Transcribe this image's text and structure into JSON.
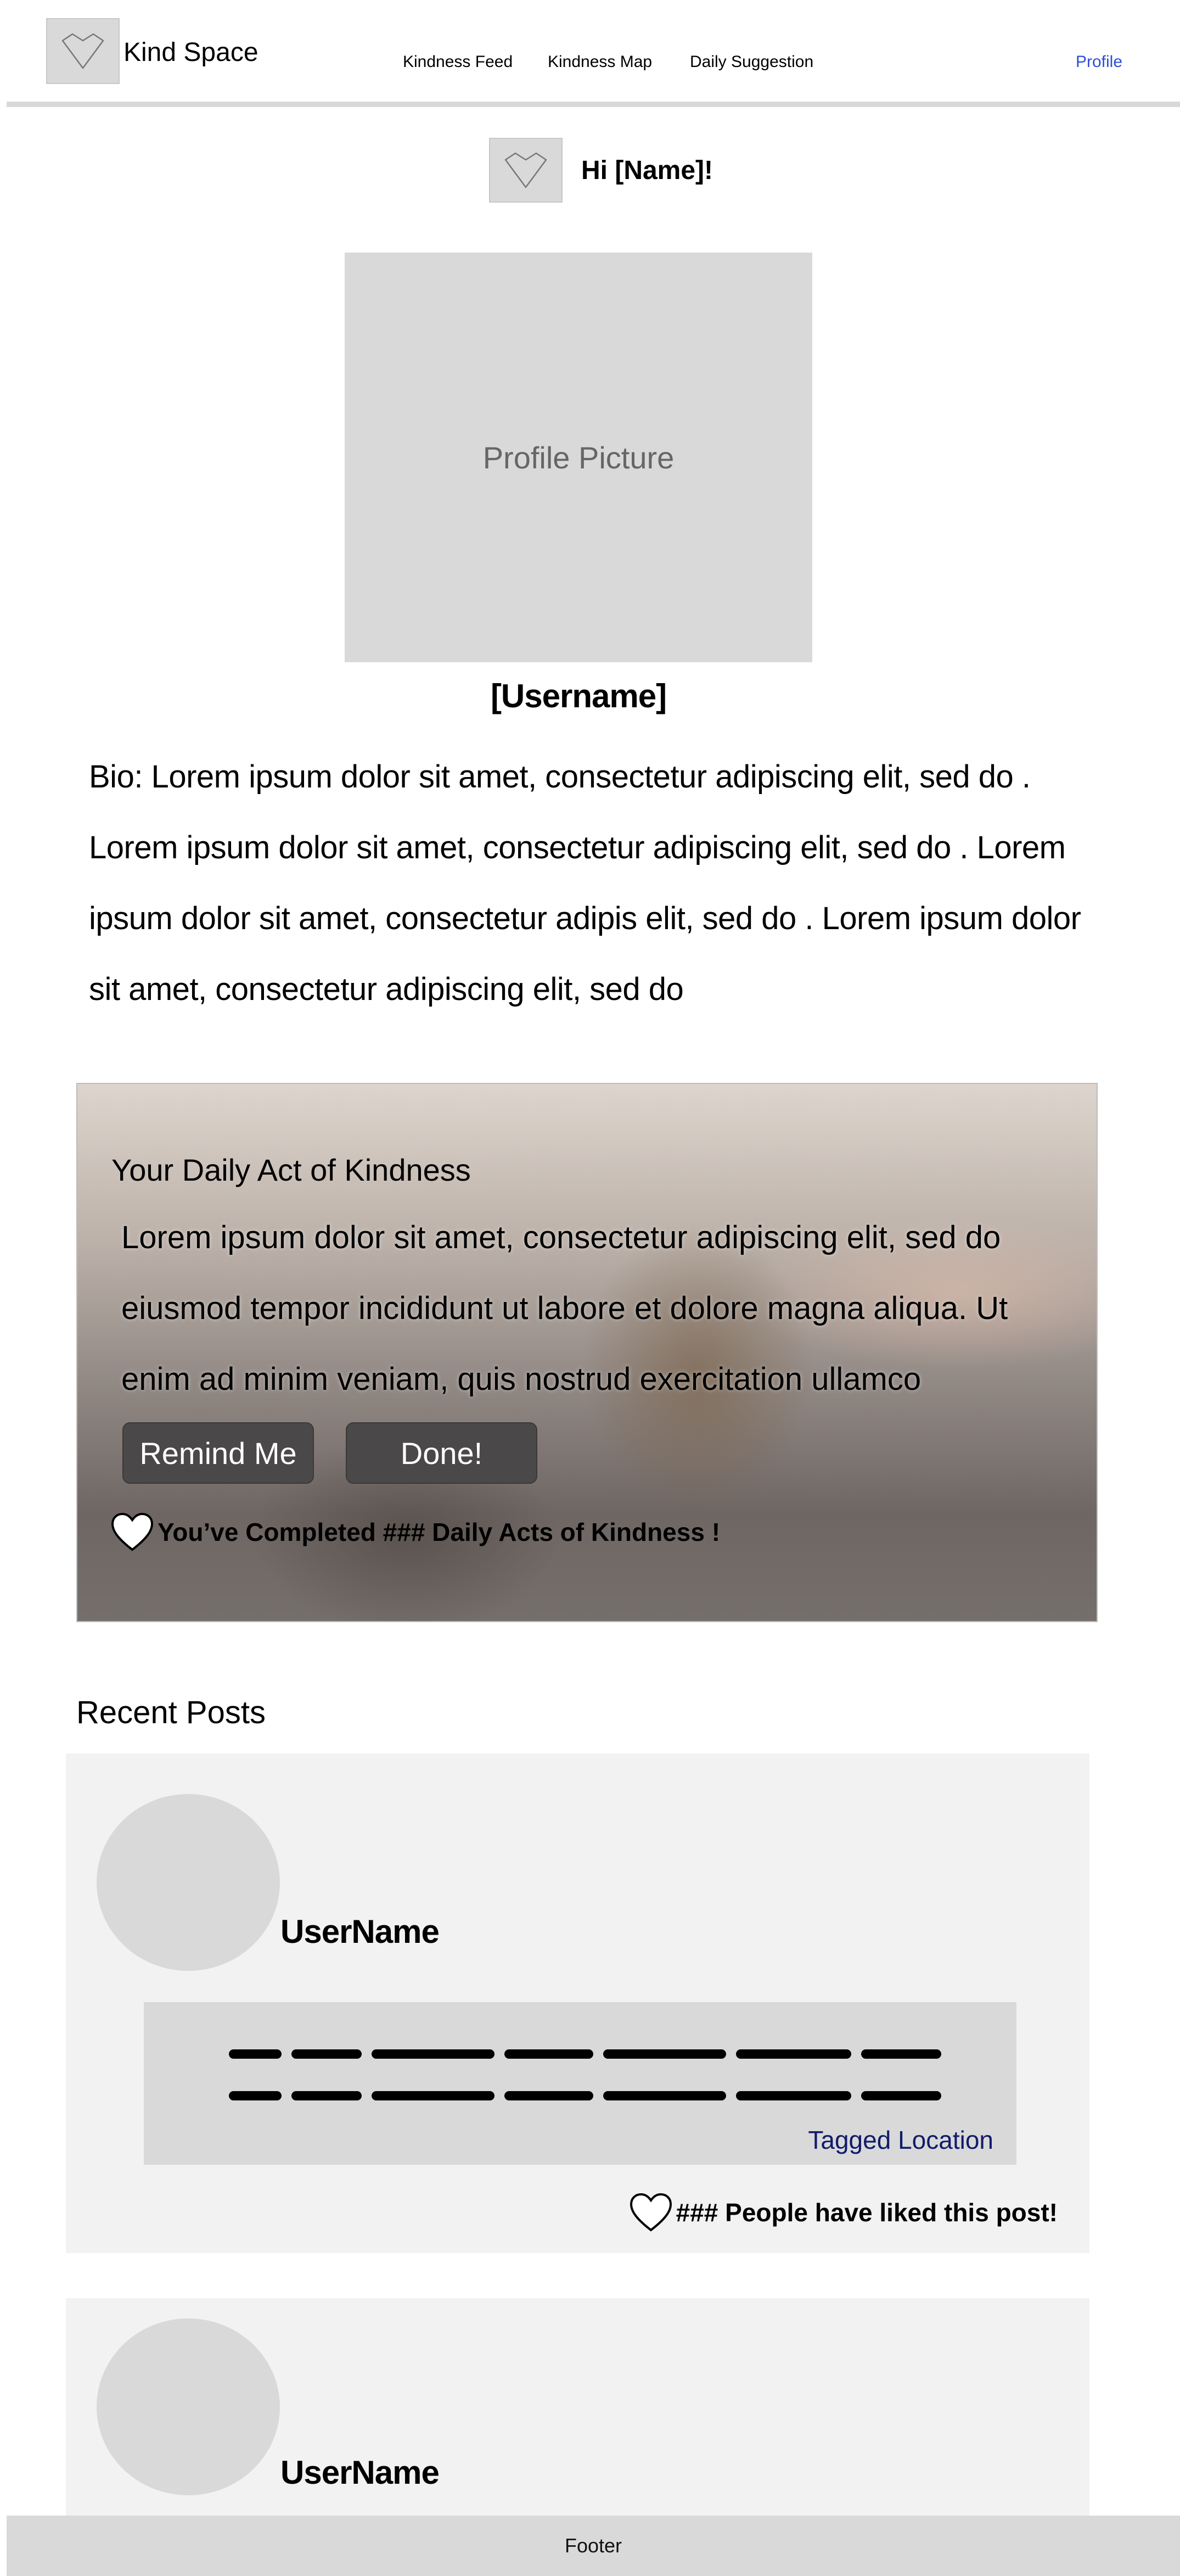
{
  "header": {
    "brand": "Kind Space",
    "nav": {
      "feed": "Kindness Feed",
      "map": "Kindness Map",
      "suggestion": "Daily Suggestion",
      "profile": "Profile"
    }
  },
  "greeting": "Hi [Name]!",
  "profile": {
    "picture_label": "Profile Picture",
    "username": "[Username]",
    "bio": "Bio:  Lorem ipsum dolor sit amet, consectetur adipiscing elit, sed do . Lorem ipsum dolor sit amet, consectetur adipiscing elit, sed do . Lorem ipsum dolor sit amet, consectetur  adipis elit, sed do . Lorem ipsum dolor sit amet, consectetur adipiscing elit, sed do"
  },
  "daily": {
    "title": "Your Daily Act of Kindness",
    "body": "Lorem ipsum dolor sit amet, consectetur  adipiscing elit, sed do eiusmod tempor incididunt  ut labore et dolore magna aliqua. Ut enim ad minim veniam, quis nostrud exercitation ullamco",
    "remind_label": "Remind Me",
    "done_label": "Done!",
    "completed_text": "You’ve Completed ### Daily Acts of Kindness !"
  },
  "recent": {
    "title": "Recent Posts",
    "posts": [
      {
        "username": "UserName",
        "tagged_location": "Tagged Location",
        "likes_text": "### People have liked this post!"
      },
      {
        "username": "UserName"
      }
    ]
  },
  "footer": "Footer",
  "colors": {
    "placeholder_gray": "#d9d9d9",
    "card_gray": "#f2f2f2",
    "profile_link": "#2b4fd8",
    "location_link": "#101c6b",
    "button": "#4a4848"
  }
}
